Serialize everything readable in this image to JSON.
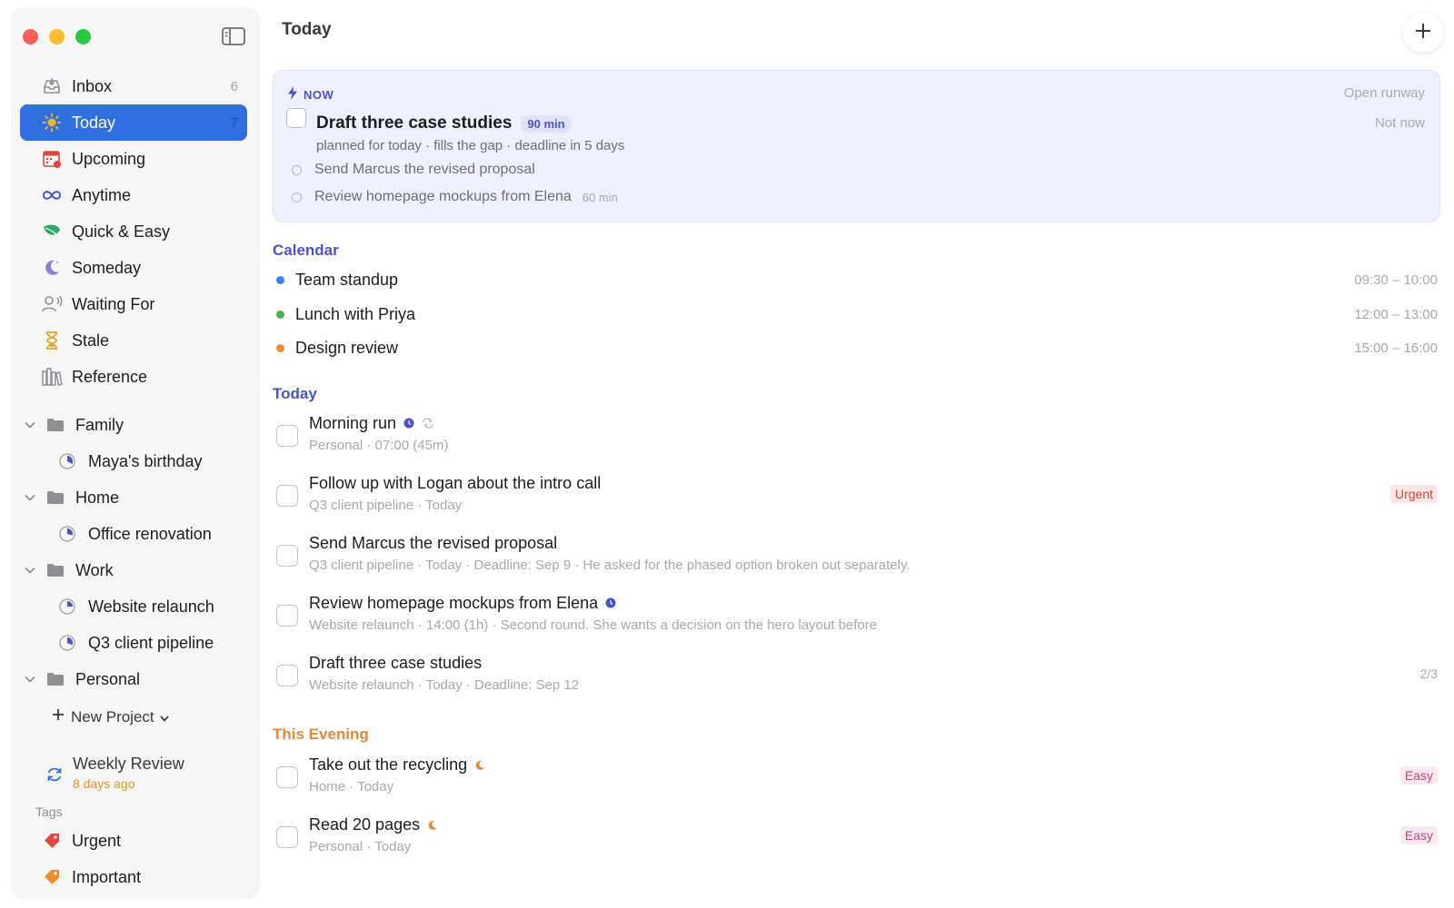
{
  "sidebar": {
    "nav": [
      {
        "label": "Inbox",
        "count": "6",
        "icon": "inbox-icon"
      },
      {
        "label": "Today",
        "count": "7",
        "icon": "sun-icon",
        "active": true
      },
      {
        "label": "Upcoming",
        "count": "",
        "icon": "calendar-icon"
      },
      {
        "label": "Anytime",
        "count": "",
        "icon": "infinity-icon"
      },
      {
        "label": "Quick & Easy",
        "count": "",
        "icon": "leaf-icon"
      },
      {
        "label": "Someday",
        "count": "",
        "icon": "moon-icon"
      },
      {
        "label": "Waiting For",
        "count": "",
        "icon": "person-icon"
      },
      {
        "label": "Stale",
        "count": "",
        "icon": "hourglass-icon"
      },
      {
        "label": "Reference",
        "count": "",
        "icon": "books-icon"
      }
    ],
    "areas": [
      {
        "label": "Family",
        "projects": [
          "Maya's birthday"
        ]
      },
      {
        "label": "Home",
        "projects": [
          "Office renovation"
        ]
      },
      {
        "label": "Work",
        "projects": [
          "Website relaunch",
          "Q3 client pipeline"
        ]
      },
      {
        "label": "Personal",
        "projects": []
      }
    ],
    "new_project": "New Project",
    "weekly_review": {
      "title": "Weekly Review",
      "subtitle": "8 days ago"
    },
    "tags_label": "Tags",
    "tags": [
      {
        "label": "Urgent",
        "color": "#e0483c"
      },
      {
        "label": "Important",
        "color": "#ef8b2c"
      }
    ]
  },
  "main": {
    "title": "Today",
    "now": {
      "label": "NOW",
      "open_runway": "Open runway",
      "not_now": "Not now",
      "task": "Draft three case studies",
      "duration": "90 min",
      "meta": "planned for today · fills the gap · deadline in 5 days",
      "subtasks": [
        {
          "label": "Send Marcus the revised proposal",
          "mins": ""
        },
        {
          "label": "Review homepage mockups from Elena",
          "mins": "60 min"
        }
      ]
    },
    "calendar": {
      "heading": "Calendar",
      "events": [
        {
          "label": "Team standup",
          "time": "09:30 – 10:00",
          "color": "#3b82f6"
        },
        {
          "label": "Lunch with Priya",
          "time": "12:00 – 13:00",
          "color": "#4caf50"
        },
        {
          "label": "Design review",
          "time": "15:00 – 16:00",
          "color": "#f08a30"
        }
      ]
    },
    "today": {
      "heading": "Today",
      "tasks": [
        {
          "name": "Morning run",
          "meta": "Personal · 07:00 (45m)",
          "right": ""
        },
        {
          "name": "Follow up with Logan about the intro call",
          "meta": "Q3 client pipeline · Today",
          "right": "Urgent"
        },
        {
          "name": "Send Marcus the revised proposal",
          "meta": "Q3 client pipeline · Today · Deadline: Sep 9 · He asked for the phased option broken out separately.",
          "right": ""
        },
        {
          "name": "Review homepage mockups from Elena",
          "meta": "Website relaunch · 14:00 (1h) · Second round. She wants a decision on the hero layout before",
          "right": ""
        },
        {
          "name": "Draft three case studies",
          "meta": "Website relaunch · Today · Deadline: Sep 12",
          "right": "2/3"
        }
      ]
    },
    "evening": {
      "heading": "This Evening",
      "tasks": [
        {
          "name": "Take out the recycling",
          "meta": "Home · Today",
          "right": "Easy"
        },
        {
          "name": "Read 20 pages",
          "meta": "Personal · Today",
          "right": "Easy"
        }
      ]
    }
  },
  "colors": {
    "accent": "#2f6fe0",
    "section_heading": "#4a53c6",
    "evening_heading": "#e08a3a"
  }
}
